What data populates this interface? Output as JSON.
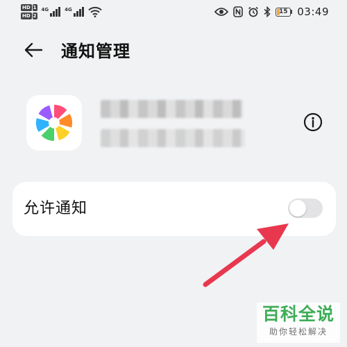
{
  "status_bar": {
    "sim1_label": "HD",
    "sim1_num": "1",
    "sim2_label": "HD",
    "sim2_num": "2",
    "network_type": "4G",
    "network_type_2": "4G",
    "battery_level": "15",
    "time": "03:49",
    "icons": [
      "eye-icon",
      "nfc-icon",
      "alarm-icon",
      "bluetooth-icon",
      "wifi-icon"
    ]
  },
  "header": {
    "title": "通知管理",
    "back_icon": "back-arrow-icon"
  },
  "app": {
    "icon": "pinwheel-app-icon",
    "info_icon": "info-icon"
  },
  "settings": {
    "allow_notifications": {
      "label": "允许通知",
      "enabled": false
    }
  },
  "colors": {
    "background": "#f1f2f4",
    "card": "#ffffff",
    "annotation_arrow": "#e8384f",
    "watermark_green": "#2fa84a"
  },
  "watermark": {
    "main": "百科全说",
    "sub": "助你轻松解决"
  }
}
